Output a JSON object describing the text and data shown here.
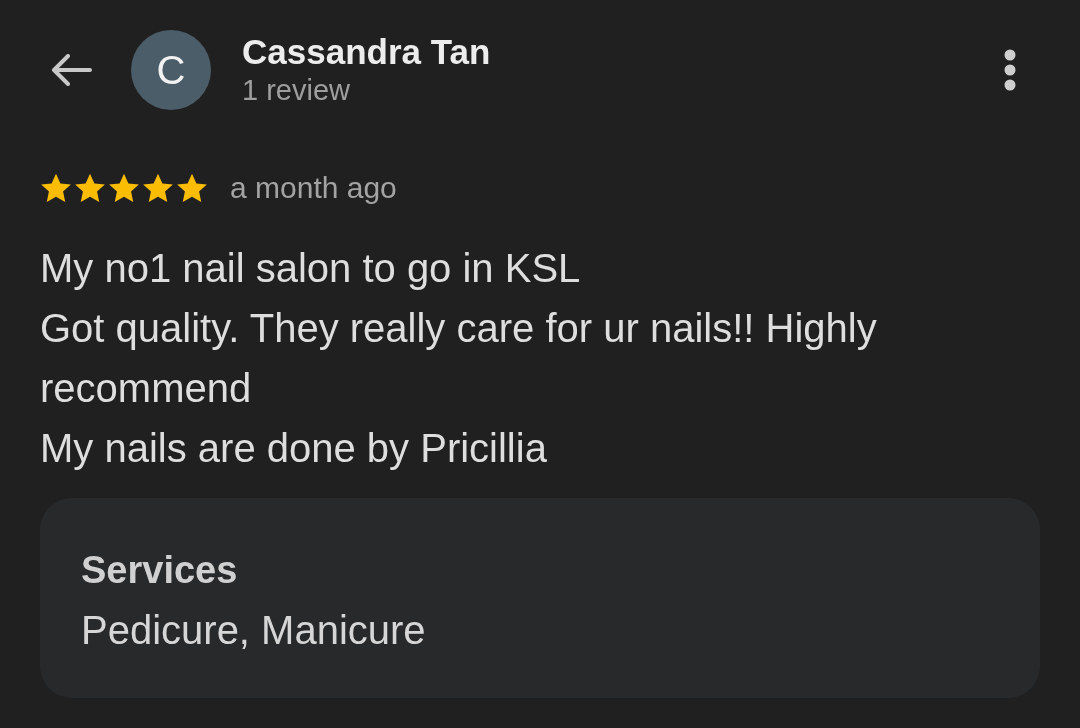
{
  "header": {
    "reviewer": {
      "initial": "C",
      "name": "Cassandra Tan",
      "review_count": "1 review"
    }
  },
  "review": {
    "stars": 5,
    "time": "a month ago",
    "lines": [
      "My no1 nail salon to go in KSL",
      "Got quality. They really care for ur nails!! Highly recommend",
      "My nails are done by Pricillia"
    ]
  },
  "services": {
    "title": "Services",
    "value": "Pedicure, Manicure"
  }
}
